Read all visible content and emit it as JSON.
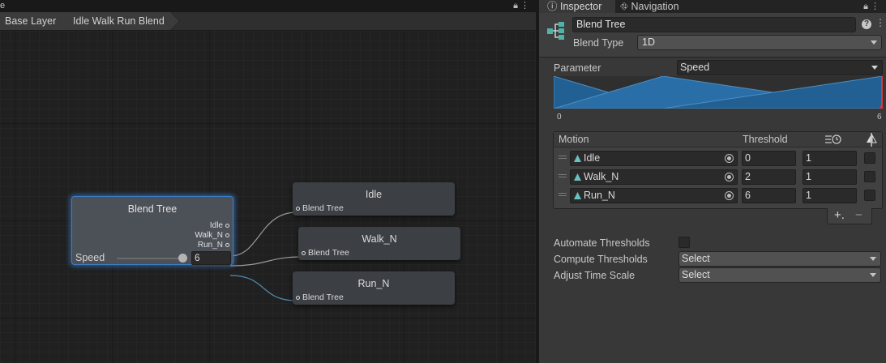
{
  "graph_window": {
    "tab_title": "e",
    "breadcrumbs": [
      "Base Layer",
      "Idle Walk Run Blend"
    ],
    "blend_tree_node": {
      "title": "Blend Tree",
      "outputs": [
        "Idle",
        "Walk_N",
        "Run_N"
      ],
      "parameter_label": "Speed",
      "parameter_value": "6",
      "slider_fraction": 1.0
    },
    "child_nodes": [
      {
        "title": "Idle",
        "port": "Blend Tree"
      },
      {
        "title": "Walk_N",
        "port": "Blend Tree"
      },
      {
        "title": "Run_N",
        "port": "Blend Tree"
      }
    ]
  },
  "inspector": {
    "tabs": [
      {
        "label": "Inspector",
        "icon": "info-icon"
      },
      {
        "label": "Navigation",
        "icon": "navigation-icon"
      }
    ],
    "header": {
      "name": "Blend Tree",
      "blend_type_label": "Blend Type",
      "blend_type_value": "1D"
    },
    "parameter_label": "Parameter",
    "parameter_value": "Speed",
    "range_min": "0",
    "range_max": "6",
    "motion_list": {
      "col_motion": "Motion",
      "col_threshold": "Threshold",
      "rows": [
        {
          "motion": "Idle",
          "threshold": "0",
          "time_scale": "1",
          "mirror": false
        },
        {
          "motion": "Walk_N",
          "threshold": "2",
          "time_scale": "1",
          "mirror": false
        },
        {
          "motion": "Run_N",
          "threshold": "6",
          "time_scale": "1",
          "mirror": false
        }
      ]
    },
    "add_label": "+.",
    "remove_label": "−",
    "automate_thresholds_label": "Automate Thresholds",
    "automate_thresholds_checked": false,
    "compute_thresholds_label": "Compute Thresholds",
    "compute_thresholds_value": "Select",
    "adjust_time_scale_label": "Adjust Time Scale",
    "adjust_time_scale_value": "Select"
  },
  "colors": {
    "accent_blue": "#3d7fc4",
    "blend_fill": "#2a6ea7",
    "threshold_marker": "#d33b3b",
    "tree_icon": "#4fb3a9"
  }
}
